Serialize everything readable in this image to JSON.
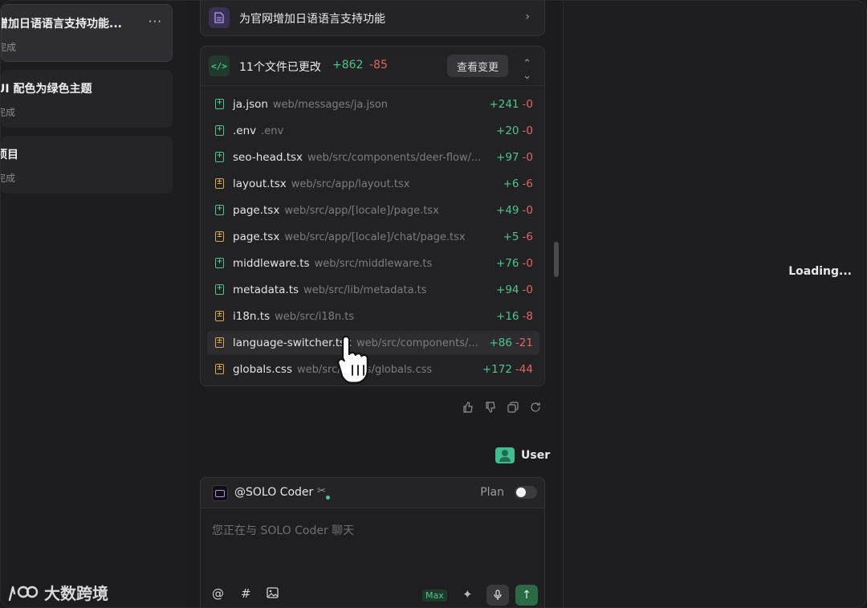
{
  "sidebar": {
    "sessions": [
      {
        "title": "增加日语语言支持功能...",
        "status": "完成",
        "active": true
      },
      {
        "title": "UI 配色为绿色主题",
        "status": "完成",
        "active": false
      },
      {
        "title": "项目",
        "status": "完成",
        "active": false
      }
    ],
    "more_label": "···",
    "brand_text": "大数跨境"
  },
  "task_card": {
    "title": "为官网增加日语语言支持功能",
    "chevron": "›"
  },
  "changes": {
    "title": "11个文件已更改",
    "additions": "+862",
    "deletions": "-85",
    "view_button": "查看变更",
    "files": [
      {
        "name": "ja.json",
        "path": "web/messages/ja.json",
        "added": "+241",
        "removed": "-0",
        "kind": "added"
      },
      {
        "name": ".env",
        "path": ".env",
        "added": "+20",
        "removed": "-0",
        "kind": "added"
      },
      {
        "name": "seo-head.tsx",
        "path": "web/src/components/deer-flow/...",
        "added": "+97",
        "removed": "-0",
        "kind": "added"
      },
      {
        "name": "layout.tsx",
        "path": "web/src/app/layout.tsx",
        "added": "+6",
        "removed": "-6",
        "kind": "modified"
      },
      {
        "name": "page.tsx",
        "path": "web/src/app/[locale]/page.tsx",
        "added": "+49",
        "removed": "-0",
        "kind": "added"
      },
      {
        "name": "page.tsx",
        "path": "web/src/app/[locale]/chat/page.tsx",
        "added": "+5",
        "removed": "-6",
        "kind": "modified"
      },
      {
        "name": "middleware.ts",
        "path": "web/src/middleware.ts",
        "added": "+76",
        "removed": "-0",
        "kind": "added"
      },
      {
        "name": "metadata.ts",
        "path": "web/src/lib/metadata.ts",
        "added": "+94",
        "removed": "-0",
        "kind": "added"
      },
      {
        "name": "i18n.ts",
        "path": "web/src/i18n.ts",
        "added": "+16",
        "removed": "-8",
        "kind": "modified"
      },
      {
        "name": "language-switcher.tsx",
        "path": "web/src/components/...",
        "added": "+86",
        "removed": "-21",
        "kind": "modified"
      },
      {
        "name": "globals.css",
        "path": "web/src/styles/globals.css",
        "added": "+172",
        "removed": "-44",
        "kind": "modified"
      }
    ]
  },
  "message_actions": [
    "thumbs-up",
    "thumbs-down",
    "copy",
    "regenerate"
  ],
  "user": {
    "name": "User"
  },
  "composer": {
    "agent": "@SOLO Coder",
    "plan_label": "Plan",
    "plan_enabled": false,
    "placeholder": "您正在与 SOLO Coder 聊天",
    "at_symbol": "@",
    "hash_symbol": "#",
    "max_label": "Max"
  },
  "preview": {
    "status": "Loading..."
  },
  "colors": {
    "accent_green": "#4fc58a",
    "deletion_red": "#e0675f",
    "modified_yellow": "#d9a94a"
  }
}
